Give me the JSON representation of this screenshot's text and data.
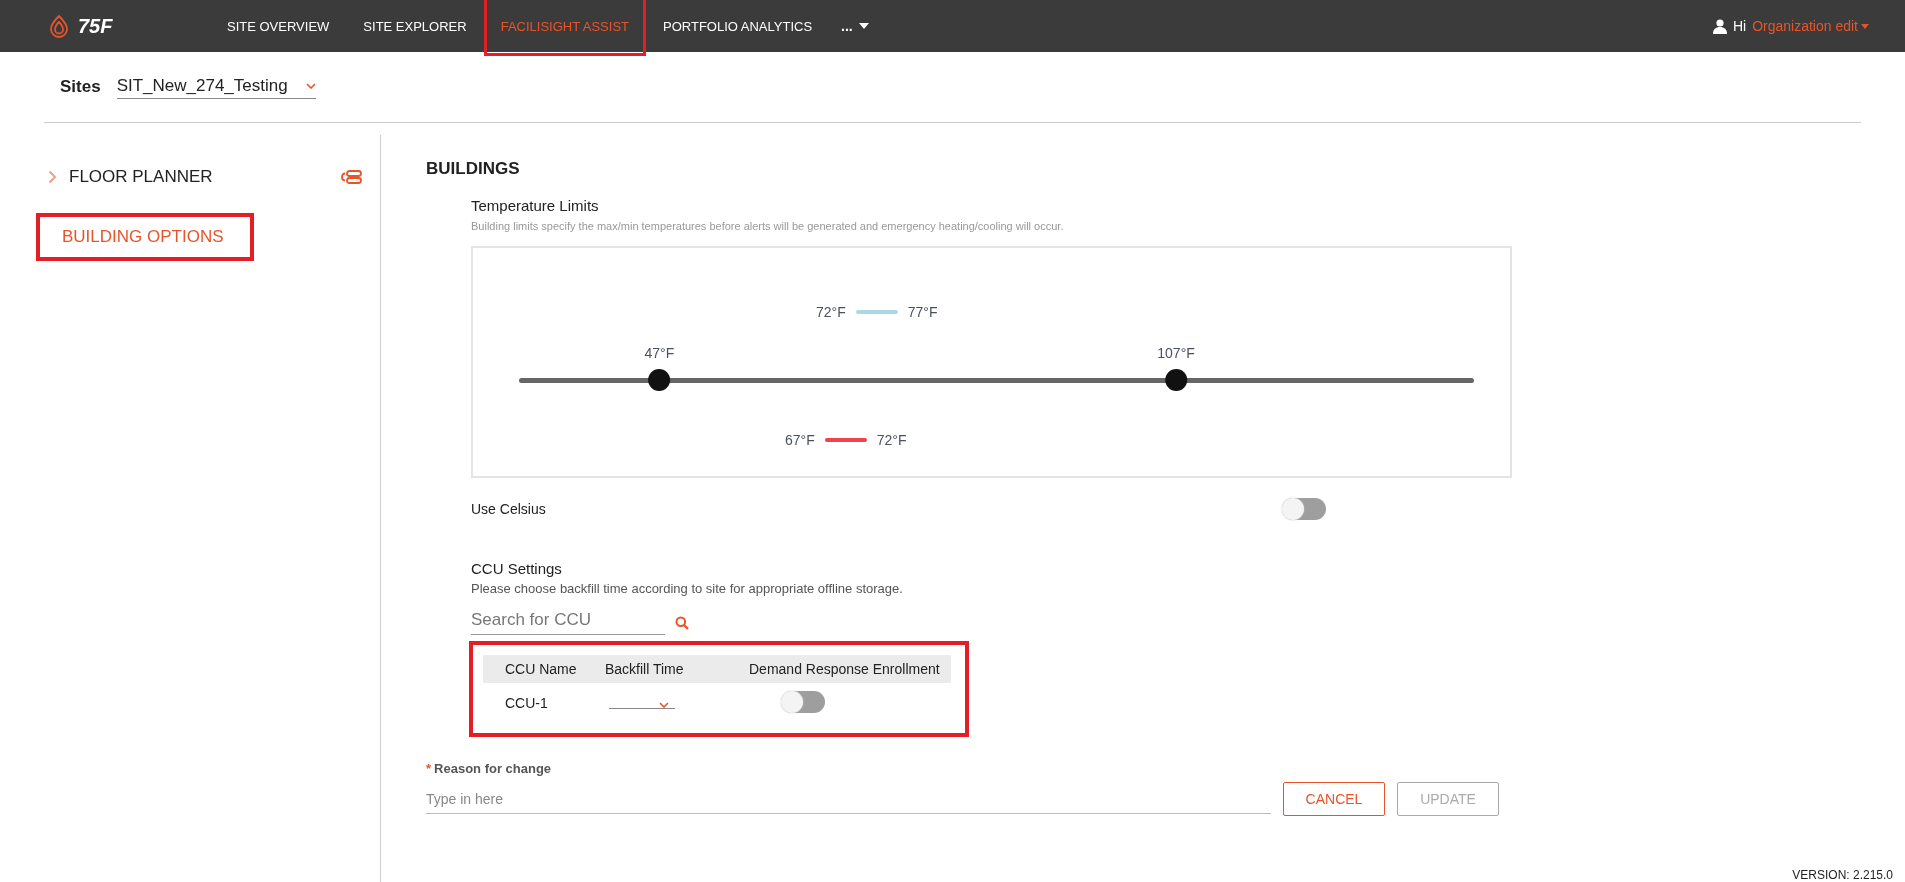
{
  "topbar": {
    "logo": "75F",
    "nav": [
      {
        "label": "SITE OVERVIEW",
        "selected": false,
        "highlighted": false
      },
      {
        "label": "SITE EXPLORER",
        "selected": false,
        "highlighted": false
      },
      {
        "label": "FACILISIGHT ASSIST",
        "selected": true,
        "highlighted": true
      },
      {
        "label": "PORTFOLIO ANALYTICS",
        "selected": false,
        "highlighted": false
      }
    ],
    "more": "...",
    "greeting": "Hi",
    "user": "Organization edit"
  },
  "sites": {
    "label": "Sites",
    "value": "SIT_New_274_Testing"
  },
  "sidebar": {
    "items": [
      {
        "label": "FLOOR PLANNER",
        "selected": false,
        "highlighted": false,
        "kind": "expandable"
      },
      {
        "label": "BUILDING OPTIONS",
        "selected": true,
        "highlighted": true,
        "kind": "plain"
      }
    ]
  },
  "main": {
    "title": "BUILDINGS",
    "temperature_limits": {
      "title": "Temperature Limits",
      "description": "Building limits specify the max/min temperatures before alerts will be generated and emergency heating/cooling will occur.",
      "thumbs": [
        {
          "label": "47°F",
          "level": 0.147
        },
        {
          "label": "107°F",
          "level": 0.688
        }
      ],
      "ranges": [
        {
          "low": "72°F",
          "high": "77°F",
          "color": "#a8d8e8"
        },
        {
          "low": "67°F",
          "high": "72°F",
          "color": "#f0434e"
        }
      ]
    },
    "use_celsius": {
      "label": "Use Celsius",
      "on": false
    },
    "ccu_settings": {
      "title": "CCU Settings",
      "description": "Please choose backfill time according to site for appropriate offline storage.",
      "search": {
        "placeholder": "Search for CCU"
      },
      "table": {
        "highlighted": true,
        "columns": [
          "CCU Name",
          "Backfill Time",
          "Demand Response Enrollment"
        ],
        "rows": [
          {
            "name": "CCU-1",
            "demand_response": false
          }
        ]
      }
    },
    "reason": {
      "label": "Reason for change",
      "required_mark": "*",
      "placeholder": "Type in here"
    },
    "buttons": [
      {
        "label": "CANCEL",
        "disabled": false
      },
      {
        "label": "UPDATE",
        "disabled": true
      }
    ]
  },
  "version": "VERSION: 2.215.0"
}
